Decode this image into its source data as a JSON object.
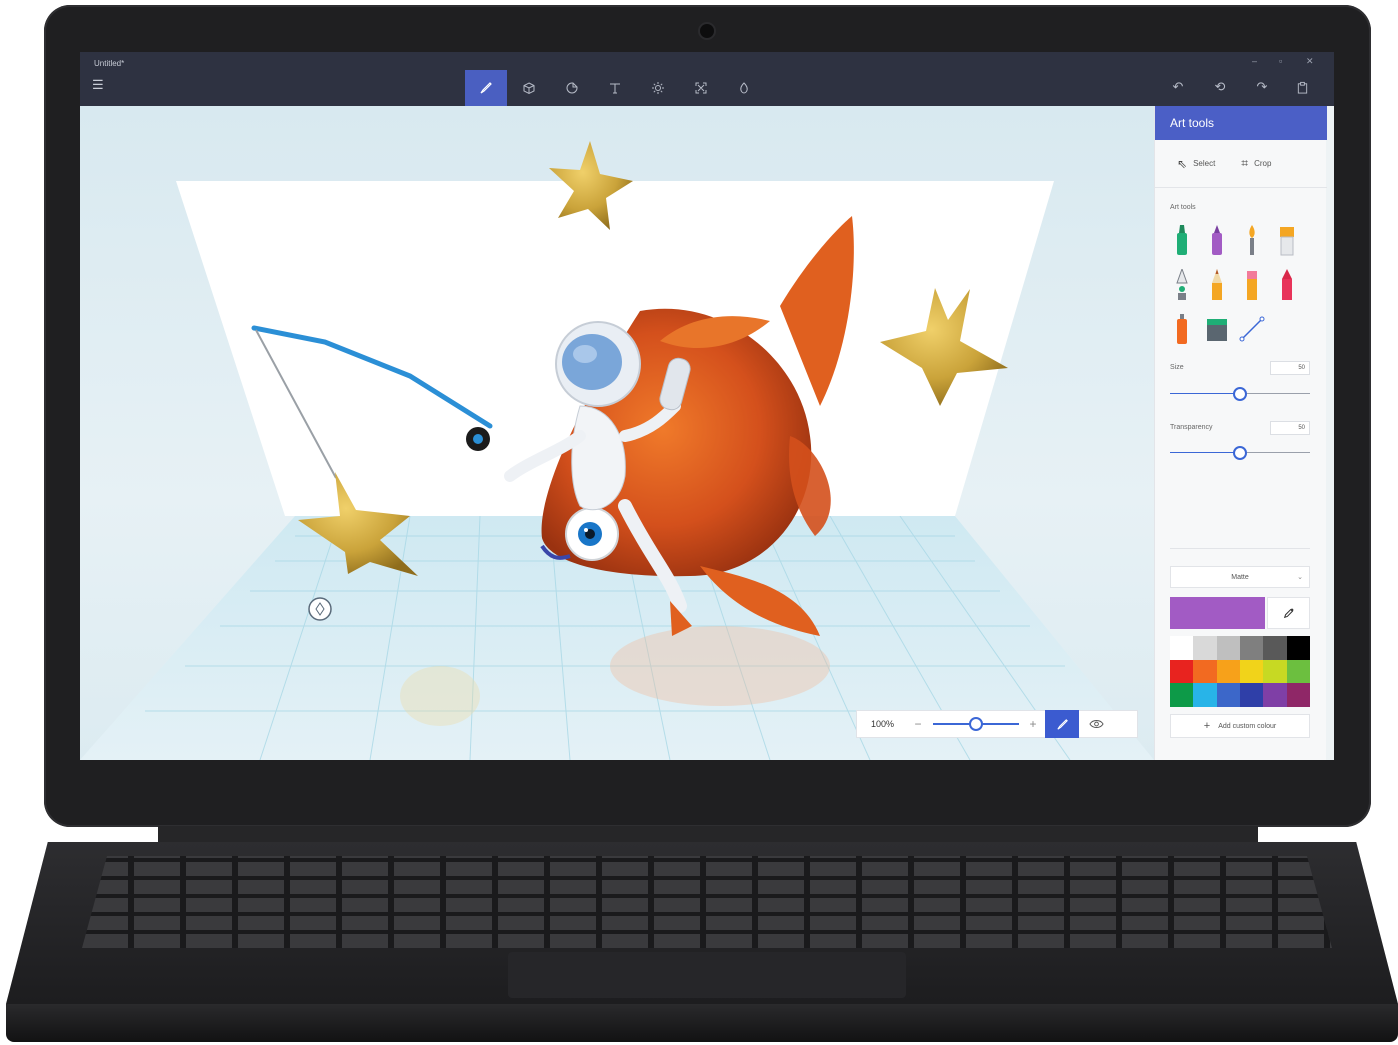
{
  "window": {
    "title": "Untitled*",
    "controls": [
      "–",
      "▫",
      "✕"
    ]
  },
  "toolbar": {
    "menu_icon": "hamburger-icon",
    "tools": [
      {
        "name": "art-tools",
        "icon": "brush-icon",
        "active": true
      },
      {
        "name": "3d-objects",
        "icon": "cube-icon",
        "active": false
      },
      {
        "name": "stickers",
        "icon": "sticker-icon",
        "active": false
      },
      {
        "name": "text",
        "icon": "text-icon",
        "active": false
      },
      {
        "name": "effects",
        "icon": "sun-icon",
        "active": false
      },
      {
        "name": "canvas",
        "icon": "canvas-resize-icon",
        "active": false
      },
      {
        "name": "3d-library",
        "icon": "library-icon",
        "active": false
      }
    ],
    "right_icons": [
      "undo-icon",
      "history-icon",
      "redo-icon",
      "paste-icon"
    ]
  },
  "panel": {
    "title": "Art tools",
    "select_label": "Select",
    "crop_label": "Crop",
    "section_label": "Art tools",
    "brushes": [
      "marker-icon",
      "calligraphy-pen-icon",
      "oil-brush-icon",
      "watercolor-icon",
      "pixel-pen-icon",
      "pencil-icon",
      "eraser-icon",
      "crayon-icon",
      "spray-can-icon",
      "fill-icon",
      "line-icon"
    ],
    "size_label": "Size",
    "size_value": "50",
    "size_level": 0.5,
    "transparency_label": "Transparency",
    "transparency_value": "50",
    "transparency_level": 0.5,
    "finish": "Matte",
    "current_color": "#a25bc4",
    "swatches": [
      "#ffffff",
      "#d9d9d9",
      "#bfbfbf",
      "#7f7f7f",
      "#595959",
      "#000000",
      "#e8231f",
      "#f26a21",
      "#f7a11a",
      "#f1d31a",
      "#c7d923",
      "#6cbf3f",
      "#0d9a48",
      "#28b4e8",
      "#3c67c9",
      "#2f3fa8",
      "#7f3fa6",
      "#8f2767"
    ],
    "add_colour_label": "Add custom colour"
  },
  "zoom": {
    "label": "100%",
    "level": 0.5
  },
  "colors": {
    "titlebar": "#2e3241",
    "accent": "#4b5fc6"
  }
}
